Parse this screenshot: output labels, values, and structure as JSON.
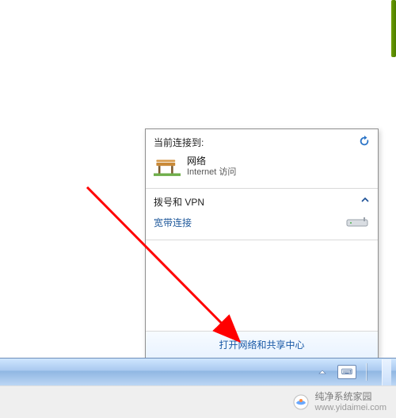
{
  "flyout": {
    "current_connection_heading": "当前连接到:",
    "network": {
      "name": "网络",
      "subtext": "Internet 访问"
    },
    "dial_vpn_heading": "拨号和 VPN",
    "dial_item_label": "宽带连接",
    "footer_link": "打开网络和共享中心"
  },
  "icons": {
    "refresh": "refresh-icon",
    "bench": "park-bench-icon",
    "caret_up": "caret-up-icon",
    "modem": "modem-icon",
    "tray_up": "tray-up-icon",
    "ime": "ime-icon",
    "show_desktop": "show-desktop-button",
    "wm_logo": "watermark-logo-icon"
  },
  "watermark": {
    "brand": "纯净系统家园",
    "url": "www.yidaimei.com"
  },
  "colors": {
    "link": "#1959a6",
    "flyout_border": "#8f8f8f",
    "taskbar_top": "#cfe6ff",
    "taskbar_bottom": "#bcd6f4",
    "arrow": "#ff0000"
  }
}
